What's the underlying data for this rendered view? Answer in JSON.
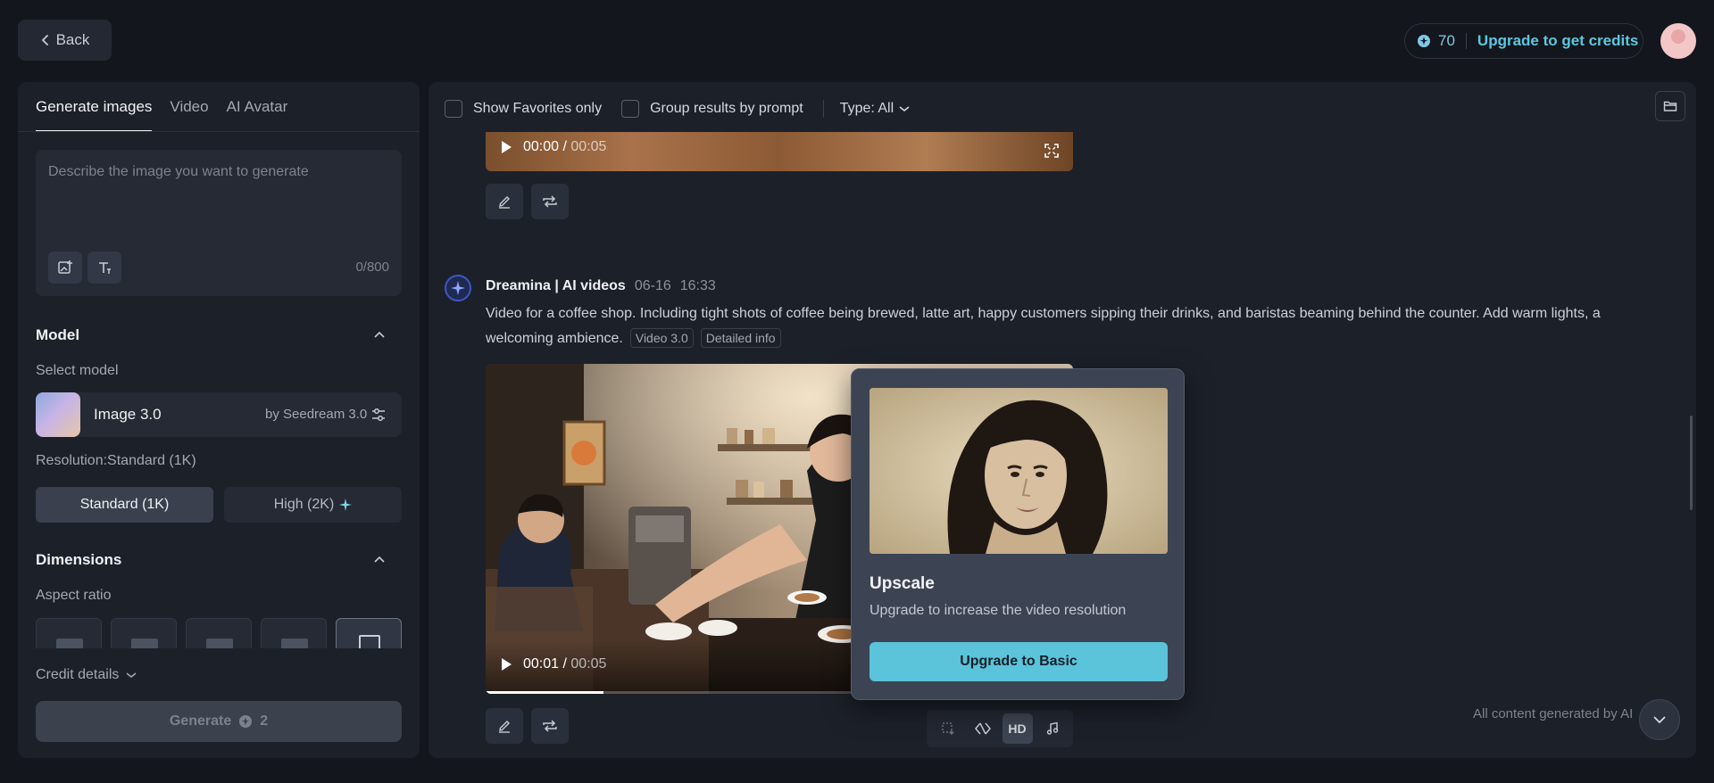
{
  "header": {
    "back_label": "Back",
    "credits_count": "70",
    "upgrade_label": "Upgrade to get credits"
  },
  "left_panel": {
    "tabs": [
      {
        "label": "Generate images"
      },
      {
        "label": "Video"
      },
      {
        "label": "AI Avatar"
      }
    ],
    "prompt": {
      "placeholder": "Describe the image you want to generate",
      "value": "",
      "char_count": "0/800"
    },
    "model_section": {
      "title": "Model",
      "select_label": "Select model",
      "model_name": "Image 3.0",
      "model_by": "by Seedream 3.0"
    },
    "resolution": {
      "label": "Resolution:Standard (1K)",
      "options": [
        "Standard (1K)",
        "High (2K)"
      ],
      "selected": "Standard (1K)"
    },
    "dimensions": {
      "title": "Dimensions",
      "aspect_label": "Aspect ratio",
      "selected_index": 4
    },
    "credit_details_label": "Credit details",
    "generate": {
      "label": "Generate",
      "cost": "2"
    }
  },
  "results": {
    "toolbar": {
      "favorites_label": "Show Favorites only",
      "group_label": "Group results by prompt",
      "type_label": "Type: All"
    },
    "video1": {
      "current_time": "00:00",
      "time_sep": "/",
      "duration": "00:05",
      "progress": 0
    },
    "generation": {
      "name": "Dreamina | AI videos",
      "date": "06-16",
      "time": "16:33",
      "prompt": "Video for a coffee shop. Including tight shots of coffee being brewed, latte art, happy customers sipping their  drinks, and baristas beaming behind the counter. Add warm lights, a welcoming ambience.",
      "tags": [
        "Video 3.0",
        "Detailed info"
      ]
    },
    "video2": {
      "current_time": "00:01",
      "time_sep": "/",
      "duration": "00:05",
      "progress": 0.2
    },
    "bottom_tools": {
      "hd_label": "HD"
    },
    "footer_note": "All content generated by AI"
  },
  "upscale_popup": {
    "title": "Upscale",
    "description": "Upgrade to increase the video resolution",
    "button_label": "Upgrade to Basic"
  },
  "colors": {
    "accent": "#5bc3da",
    "background": "#13161c",
    "panel": "#1c2029"
  }
}
